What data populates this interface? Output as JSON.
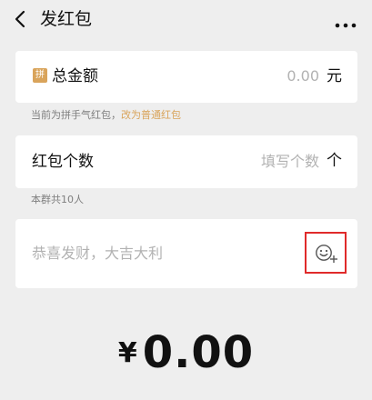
{
  "header": {
    "title": "发红包",
    "back_icon": "chevron-left-icon",
    "more_icon": "more-dots-icon"
  },
  "amount": {
    "badge": "拼",
    "label": "总金额",
    "placeholder": "0.00",
    "unit": "元"
  },
  "type_hint": {
    "text": "当前为拼手气红包，",
    "switch_link": "改为普通红包"
  },
  "count": {
    "label": "红包个数",
    "placeholder": "填写个数",
    "unit": "个"
  },
  "group_hint": "本群共10人",
  "greeting": {
    "placeholder": "恭喜发财，大吉大利",
    "emoji_icon": "emoji-add-icon"
  },
  "total": {
    "currency": "¥",
    "amount": "0.00"
  },
  "colors": {
    "accent_gold": "#d9a45b",
    "highlight_red": "#e02a2a",
    "page_bg": "#eeeeee",
    "placeholder": "#b2b2b2"
  }
}
